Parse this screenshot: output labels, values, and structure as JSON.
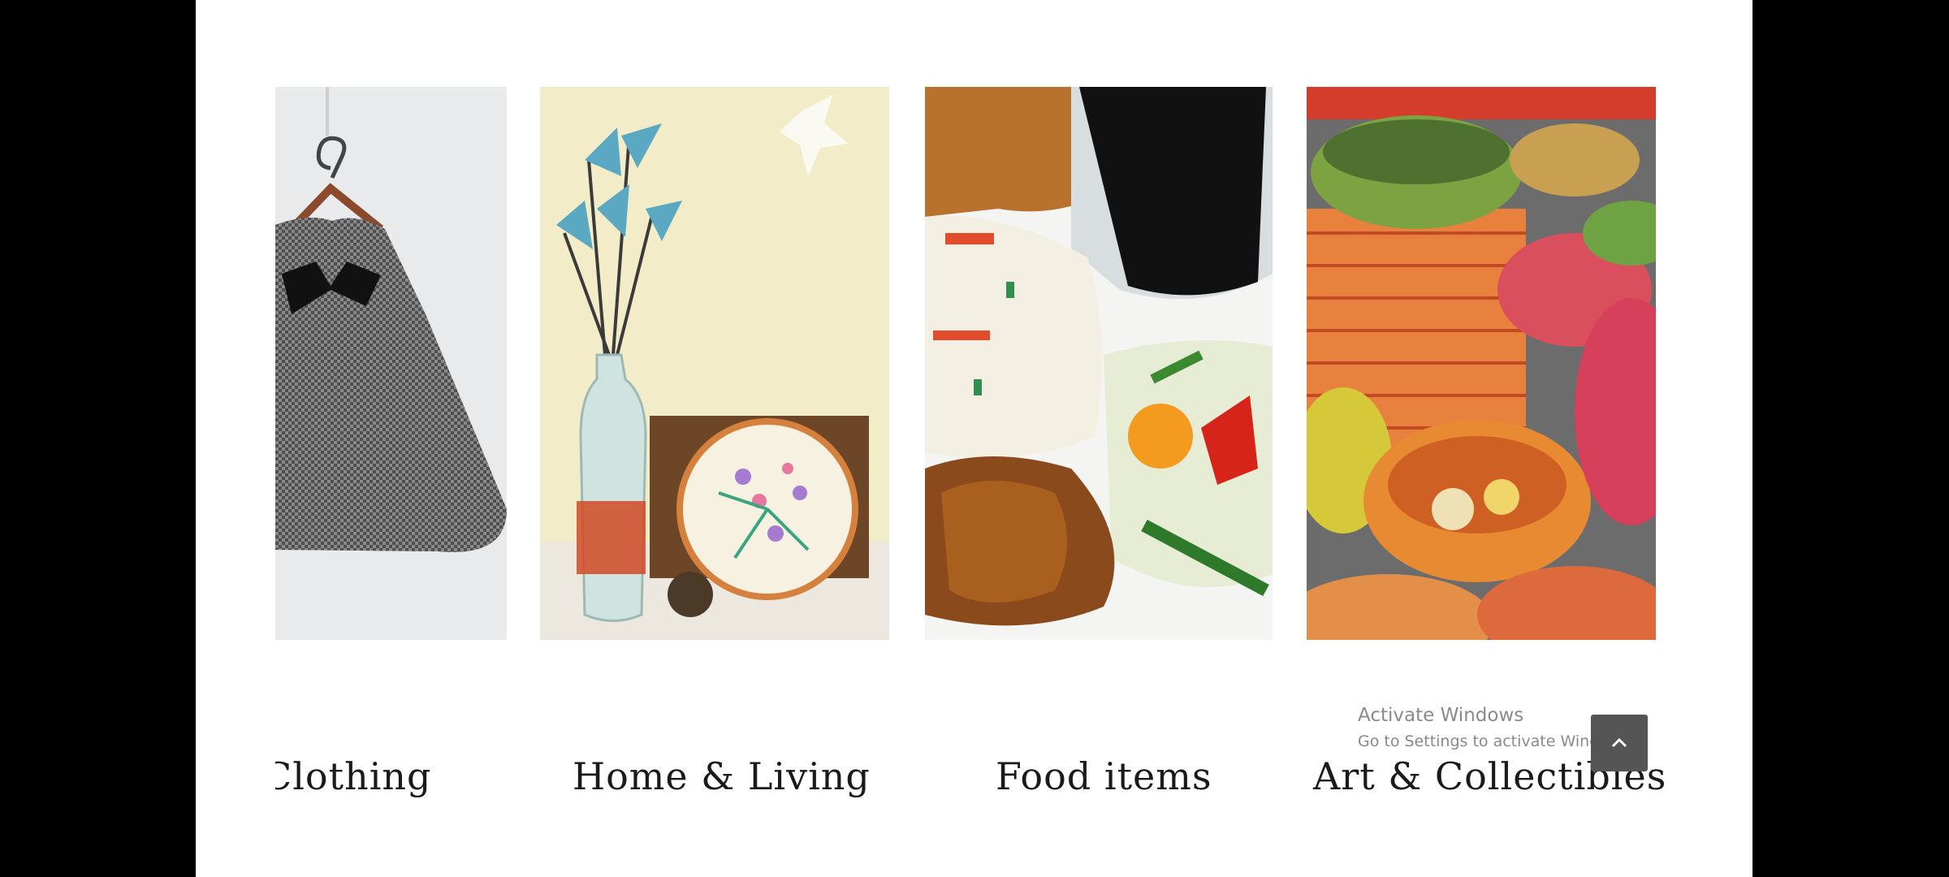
{
  "categories": [
    {
      "label": "Clothing",
      "image": "grey-dress-on-hanger"
    },
    {
      "label": "Home & Living",
      "image": "vase-and-embroidery-hoop"
    },
    {
      "label": "Food items",
      "image": "rice-chicken-vegetables-plate"
    },
    {
      "label": "Art & Collectibles",
      "image": "woven-baskets"
    }
  ],
  "watermark": {
    "title": "Activate Windows",
    "subtitle": "Go to Settings to activate Windows."
  },
  "back_to_top": {
    "icon": "chevron-up-icon"
  },
  "colors": {
    "background": "#000000",
    "page": "#ffffff",
    "caption": "#1a1a1a",
    "back_to_top": "#555555"
  }
}
